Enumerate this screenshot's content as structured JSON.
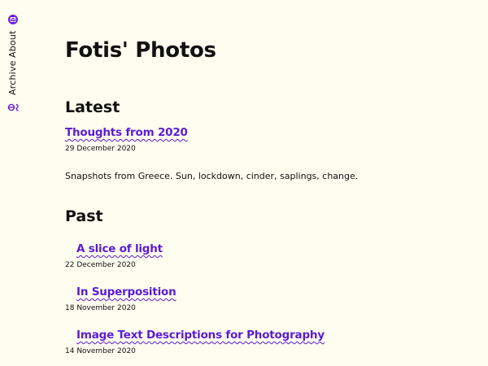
{
  "nav": {
    "logo_icon": "envelope-icon",
    "about_label": "About",
    "archive_label": "Archive",
    "settings_icon": "theme-settings-icon",
    "accent_color": "#6a1fd9"
  },
  "site": {
    "title": "Fotis' Photos",
    "background_color": "#fdfdf0",
    "link_color": "#5b1bd6"
  },
  "latest": {
    "heading": "Latest",
    "post": {
      "title": "Thoughts from 2020",
      "date": "29 December 2020",
      "description": "Snapshots from Greece. Sun, lockdown, cinder, saplings, change."
    }
  },
  "past": {
    "heading": "Past",
    "posts": [
      {
        "title": "A slice of light",
        "date": "22 December 2020"
      },
      {
        "title": "In Superposition",
        "date": "18 November 2020"
      },
      {
        "title": "Image Text Descriptions for Photography",
        "date": "14 November 2020"
      }
    ]
  }
}
